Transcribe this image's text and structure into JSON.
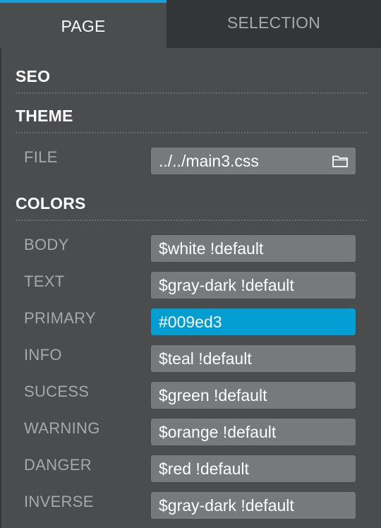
{
  "tabs": {
    "page": "PAGE",
    "selection": "SELECTION"
  },
  "sections": {
    "seo": "SEO",
    "theme": "THEME",
    "colors": "COLORS"
  },
  "theme": {
    "file_label": "FILE",
    "file_value": "../../main3.css",
    "file_icon": "folder-icon"
  },
  "colors": {
    "rows": [
      {
        "label": "BODY",
        "value": "$white !default"
      },
      {
        "label": "TEXT",
        "value": "$gray-dark !default"
      },
      {
        "label": "PRIMARY",
        "value": "#009ed3"
      },
      {
        "label": "INFO",
        "value": "$teal !default"
      },
      {
        "label": "SUCESS",
        "value": "$green !default"
      },
      {
        "label": "WARNING",
        "value": "$orange !default"
      },
      {
        "label": "DANGER",
        "value": "$red !default"
      },
      {
        "label": "INVERSE",
        "value": "$gray-dark !default"
      }
    ]
  },
  "style": {
    "accent": "#1a9fd8",
    "active_field": "#009ed3",
    "panel_bg": "#4b4c4e",
    "field_bg": "#78797b"
  }
}
